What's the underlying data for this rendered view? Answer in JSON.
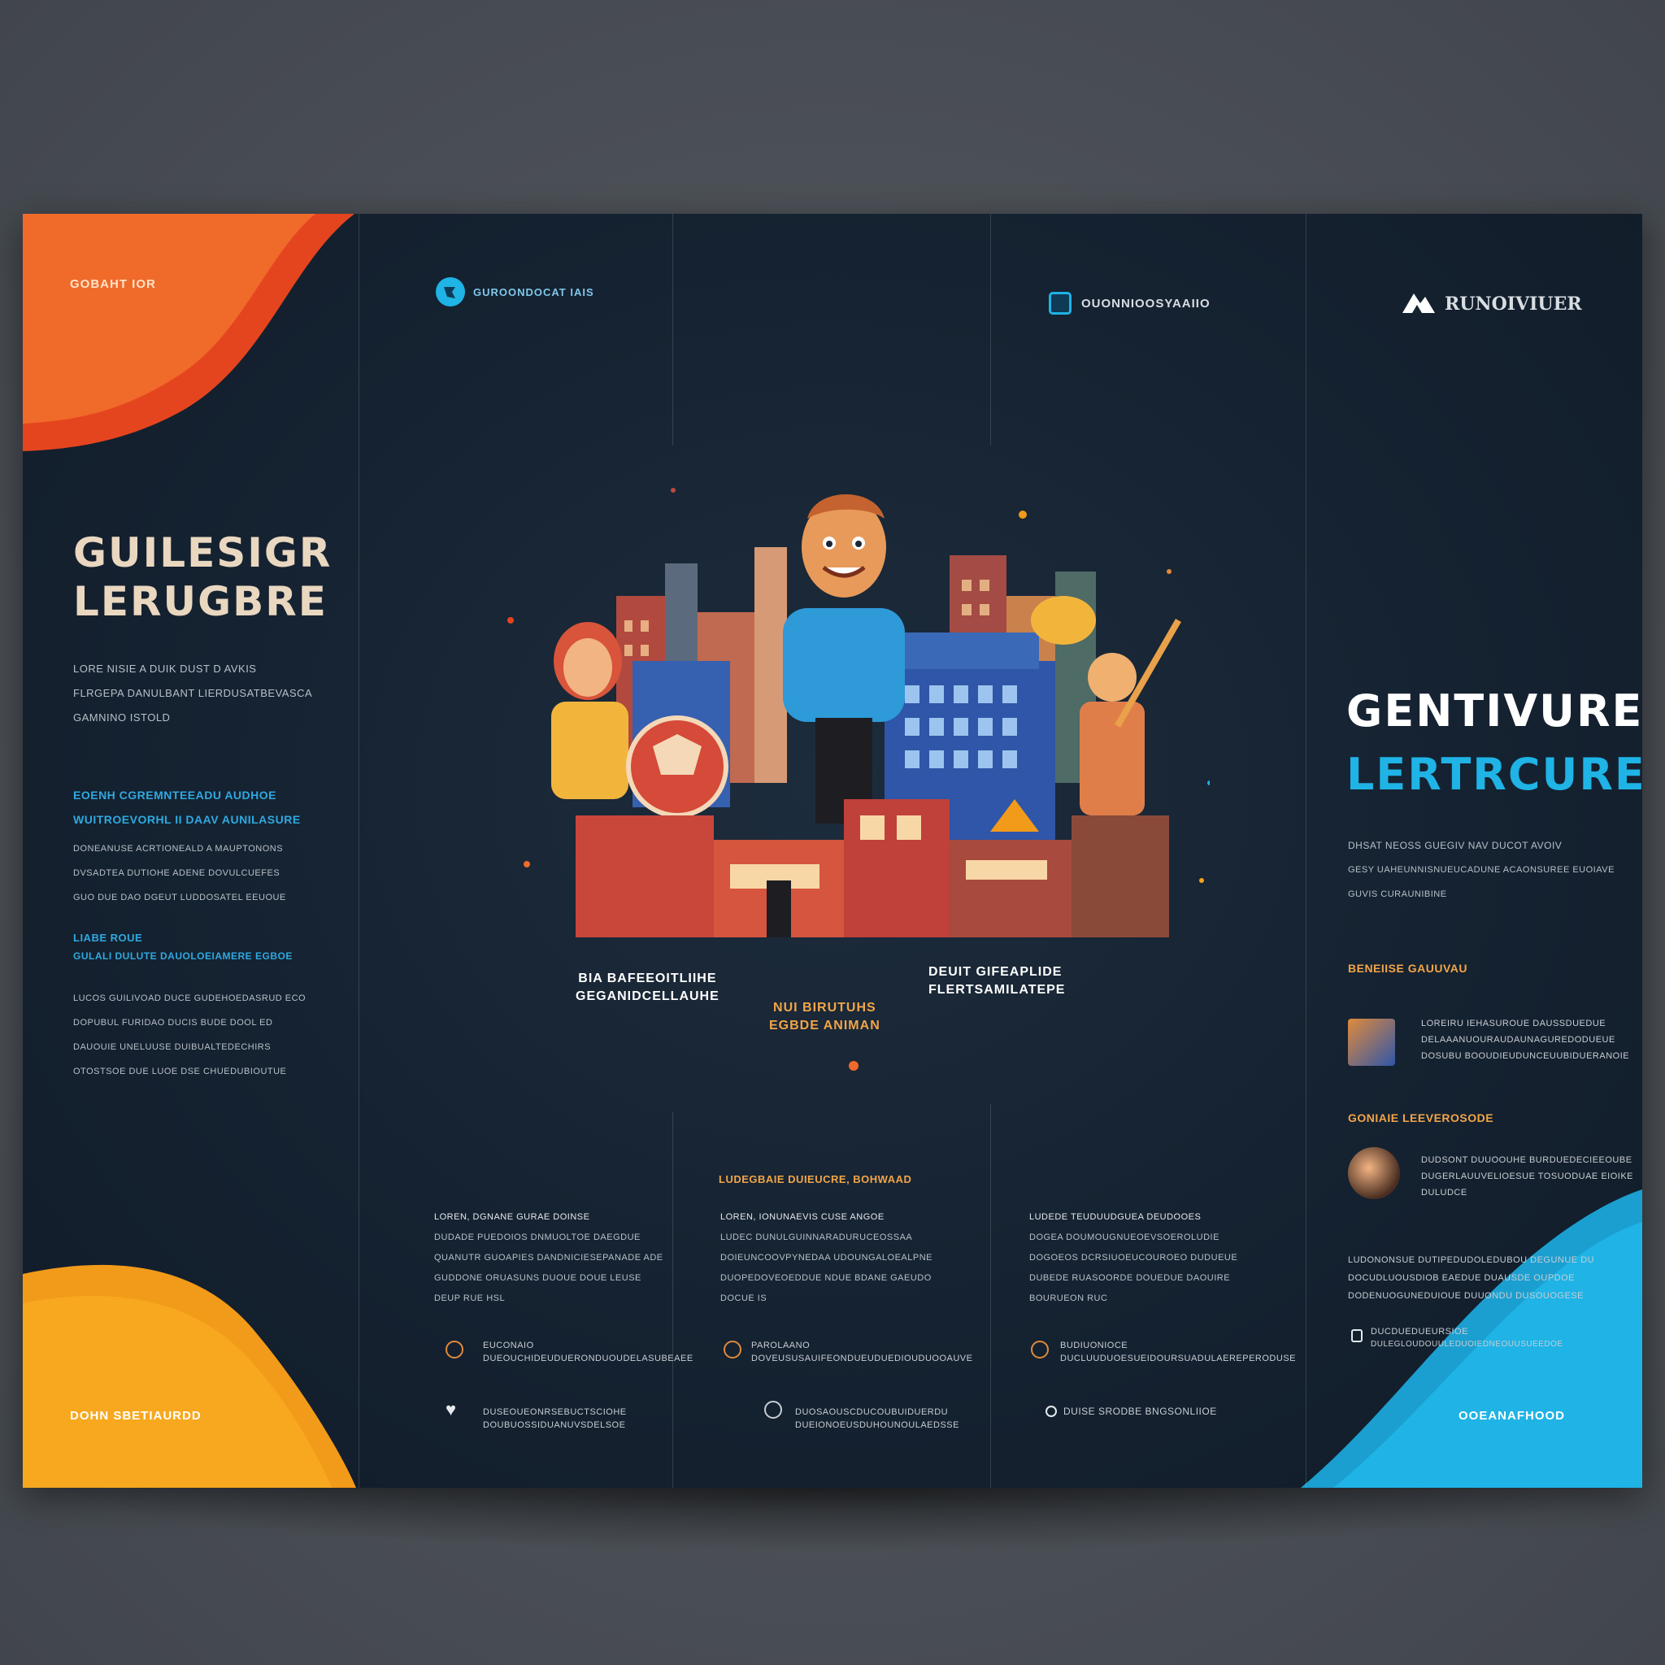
{
  "colors": {
    "background": "#4a4f55",
    "panel": "#152231",
    "accent_orange": "#f06a2a",
    "accent_yellow": "#f7a21b",
    "accent_blue": "#1fb3e6",
    "heading_cream": "#e9d7c0"
  },
  "panel1": {
    "corner_label": "GOBAHT IOR",
    "title_line1": "GUILESIGR",
    "title_line2": "LERUGBRE",
    "intro": [
      "LORE NISIE A DUIK DUST D AVKIS",
      "FLRGEPA DANULBANT LIERDUSATBEVASCA",
      "GAMNINO ISTOLD"
    ],
    "sub_heading_1": [
      "EOENH CGREMNTEEADU AUDHOE",
      "WUITROEVORHL II DAAV AUNILASURE"
    ],
    "body_1": [
      "DONEANUSE ACRTIONEALD A MAUPTONONS",
      "DVSADTEA DUTIOHE ADENE DOVULCUEFES",
      "GUO DUE DAO DGEUT LUDDOSATEL EEUOUE"
    ],
    "sub_heading_2": [
      "LIABE ROUE",
      "GULALI DULUTE DAUOLOEIAMERE EGBOE"
    ],
    "body_2": [
      "LUCOS GUILIVOAD DUCE GUDEHOEDASRUD ECO",
      "DOPUBUL FURIDAO DUCIS BUDE DOOL ED",
      "DAUOUIE UNELUUSE DUIBUALTEDECHIRS",
      "OTOSTSOE DUE LUOE DSE CHUEDUBIOUTUE"
    ],
    "footer_label": "DOHN SBETIAURDD"
  },
  "panel2": {
    "logo_text": "GUROONDOCAT IAIS",
    "column": [
      "LOREN, DGNANE GURAE DOINSE",
      "DUDADE PUEDOIOS DNMUOLTOE DAEGDUE",
      "QUANUTR GUOAPIES DANDNICIESEPANADE ADE",
      "GUDDONE ORUASUNS DUOUE DOUE LEUSE",
      "DEUP RUE HSL"
    ],
    "contact_1": [
      "EUCONAIO",
      "DUEOUCHIDEUDUERONDUOUDELASUBEAEE"
    ],
    "contact_2": [
      "DUSEOUEONRSEBUCTSCIOHE",
      "DOUBUOSSIDUANUVSDELSOE"
    ]
  },
  "panel3": {
    "captions": {
      "left": [
        "BIA BAFEEOITLIIHE",
        "GEGANIDCELLAUHE"
      ],
      "center": [
        "NUI BIRUTUHS",
        "EGBDE ANIMAN"
      ],
      "right": [
        "DEUIT GIFEAPLIDE",
        "FLERTSAMILATEPE"
      ]
    },
    "mid_heading": "LUDEGBAIE DUIEUCRE, BOHWAAD",
    "column": [
      "LOREN, IONUNAEVIS CUSE ANGOE",
      "LUDEC DUNULGUINNARADURUCEOSSAA",
      "DOIEUNCOOVPYNEDAA UDOUNGALOEALPNE",
      "DUOPEDOVEOEDDUE NDUE BDANE GAEUDO",
      "DOCUE IS"
    ],
    "contact_1": [
      "PAROLAANO",
      "DOVEUSUSAUIFEONDUEUDUEDIOUDUOOAUVE"
    ],
    "contact_2": [
      "DUOSAOUSCDUCOUBUIDUERDU",
      "DUEIONOEUSDUHOUNOULAEDSSE"
    ]
  },
  "panel4": {
    "logo_text": "OUONNIOOSYAAIIO",
    "column": [
      "LUDEDE TEUDUUDGUEA DEUDOOES",
      "DOGEA DOUMOUGNUEOEVSOEROLUDIE",
      "DOGOEOS DCRSIUOEUCOUROEO DUDUEUE",
      "DUBEDE RUASOORDE DOUEDUE DAOUIRE",
      "BOURUEON RUC"
    ],
    "contact_1": [
      "BUDIUONIOCE",
      "DUCLUUDUOESUEIDOURSUADULAEREPERODUSE"
    ],
    "contact_2": [
      "DUISE SRODBE BNGSONLIIOE"
    ]
  },
  "panel5": {
    "logo_text": "RUNOIVIUER",
    "title_line1": "GENTIVURE",
    "title_line2": "LERTRCURE",
    "intro": [
      "DHSAT NEOSS GUEGIV NAV DUCOT AVOIV",
      "GESY UAHEUNNISNUEUCADUNE ACAONSUREE EUOIAVE",
      "GUVIS CURAUNIBINE"
    ],
    "section_1_title": "BENEIISE GAUUVAU",
    "section_1_text": [
      "LOREIRU IEHASUROUE DAUSSDUEDUE",
      "DELAAANUOURAUDAUNAGUREDODUEUE",
      "DOSUBU BOOUDIEUDUNCEUUBIDUERANOIE"
    ],
    "section_2_title": "GONIAIE LEEVEROSODE",
    "section_2_text": [
      "DUDSONT DUUOOUHE BURDUEDECIEEOUBE",
      "DUGERLAUUVELIOESUE TOSUODUAE EIOIKE",
      "DULUDCE"
    ],
    "body": [
      "LUDONONSUE DUTIPEDUDOLEDUBOU DEGUNUE DU",
      "DOCUDLUOUSDIOB EAEDUE DUAUSDE OUPDOE",
      "DODENUOGUNEDUIOUE DUUONDU DUSOUOGESE"
    ],
    "contact": [
      "DUCDUEDUEURSIOE",
      "DULEGLOUDOUULEDUOIEDNEOUUSUEEDOE"
    ],
    "footer_label": "OOEANAFHOOD"
  }
}
